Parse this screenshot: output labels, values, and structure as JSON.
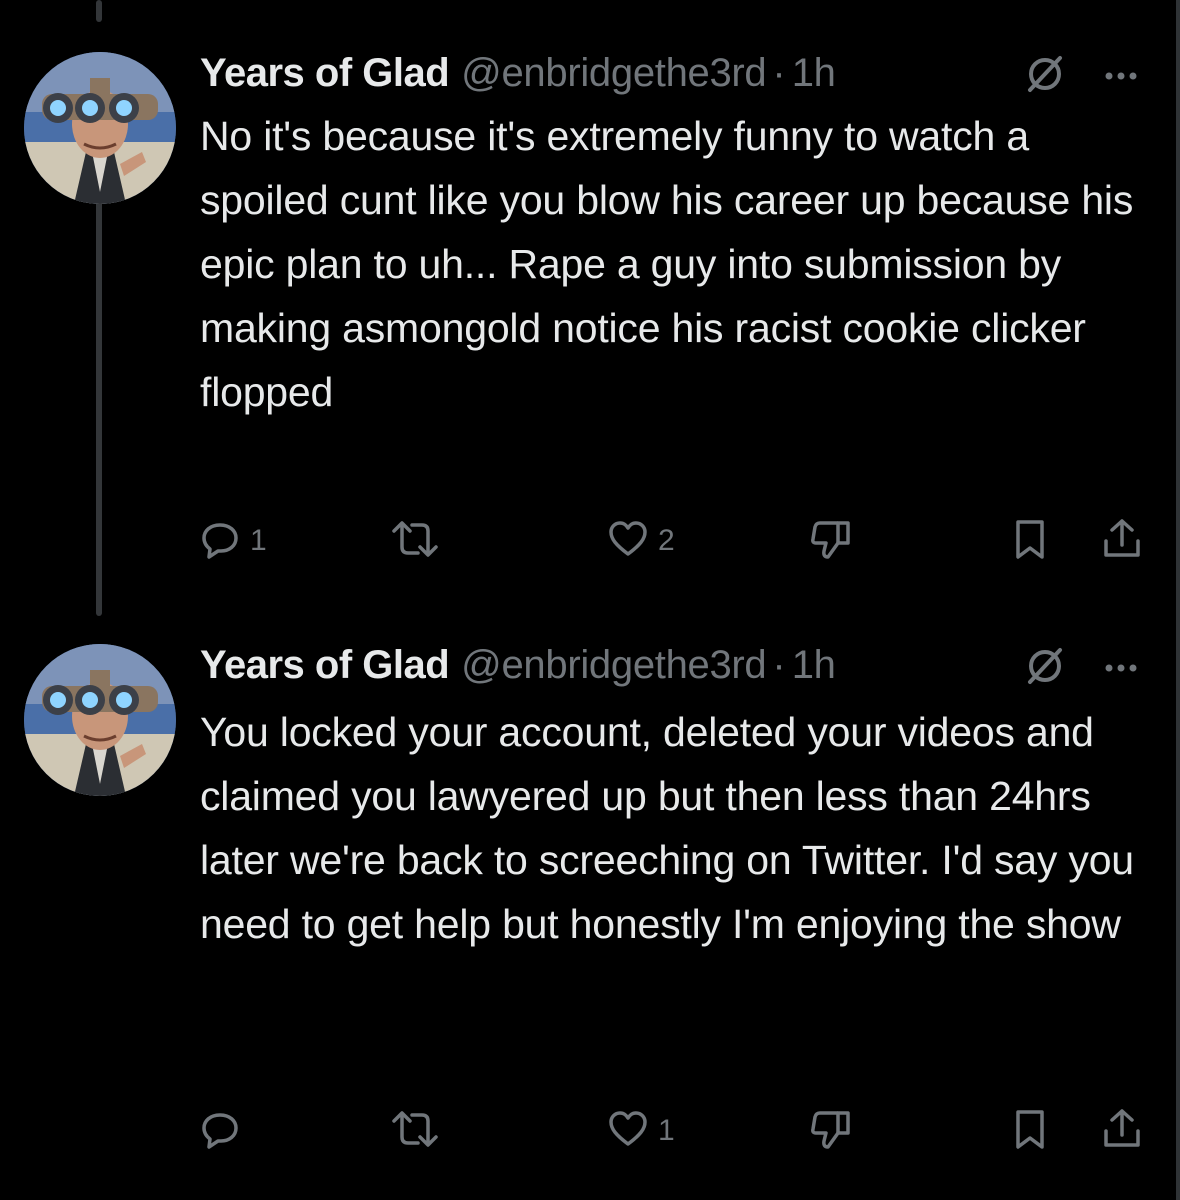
{
  "tweets": [
    {
      "name": "Years of Glad",
      "handle": "@enbridgethe3rd",
      "separator": "·",
      "time": "1h",
      "text": "No it's because it's extremely funny to watch a spoiled cunt like you blow his career up because his epic plan to uh... Rape a guy into submission by making asmongold notice his racist cookie clicker flopped",
      "reply_count": "1",
      "retweet_count": "",
      "like_count": "2"
    },
    {
      "name": "Years of Glad",
      "handle": "@enbridgethe3rd",
      "separator": "·",
      "time": "1h",
      "text": "You locked your account, deleted your videos and claimed you lawyered up but then less than 24hrs later we're back to screeching on Twitter. I'd say you need to get help but honestly I'm enjoying the show",
      "reply_count": "",
      "retweet_count": "",
      "like_count": "1"
    }
  ],
  "icons": {
    "not_following": "slashed-circle-icon",
    "more": "more-dots-icon",
    "reply": "reply-icon",
    "retweet": "retweet-icon",
    "like": "heart-icon",
    "dislike": "thumbs-down-icon",
    "bookmark": "bookmark-icon",
    "share": "share-icon"
  },
  "colors": {
    "background": "#000000",
    "text_primary": "#e7e9ea",
    "text_secondary": "#71767b",
    "thread_line": "#333639"
  }
}
